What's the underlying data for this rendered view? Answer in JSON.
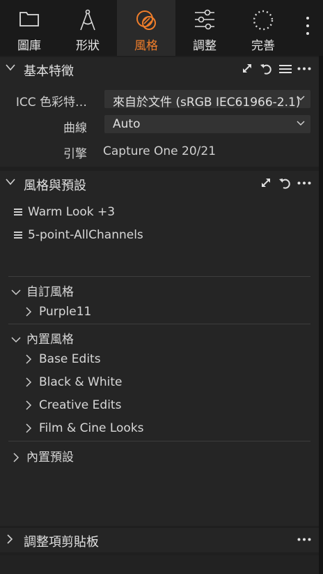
{
  "tabs": [
    {
      "label": "圖庫",
      "icon": "folder-icon",
      "active": false
    },
    {
      "label": "形狀",
      "icon": "compass-icon",
      "active": false
    },
    {
      "label": "風格",
      "icon": "style-icon",
      "active": true
    },
    {
      "label": "調整",
      "icon": "sliders-icon",
      "active": false
    },
    {
      "label": "完善",
      "icon": "dotted-circle-icon",
      "active": false
    }
  ],
  "accent_color": "#f07e2b",
  "base_characteristics": {
    "title": "基本特徵",
    "icc_label": "ICC 色彩特…",
    "icc_value": "來自於文件 (sRGB IEC61966-2.1)",
    "curve_label": "曲線",
    "curve_value": "Auto",
    "engine_label": "引擎",
    "engine_value": "Capture One 20/21"
  },
  "styles_presets": {
    "title": "風格與預設",
    "applied": [
      "Warm Look +3",
      "5-point-AllChannels"
    ],
    "custom_styles": {
      "title": "自訂風格",
      "items": [
        "Purple11"
      ]
    },
    "builtin_styles": {
      "title": "內置風格",
      "items": [
        "Base Edits",
        "Black & White",
        "Creative Edits",
        "Film & Cine Looks"
      ]
    },
    "builtin_presets": {
      "title": "內置預設"
    }
  },
  "clipboard": {
    "title": "調整項剪貼板"
  }
}
